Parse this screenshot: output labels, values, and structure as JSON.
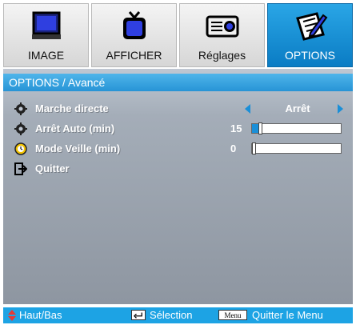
{
  "tabs": [
    {
      "label": "IMAGE",
      "icon": "monitor-icon",
      "active": false
    },
    {
      "label": "AFFICHER",
      "icon": "tv-icon",
      "active": false
    },
    {
      "label": "Réglages",
      "icon": "projector-icon",
      "active": false
    },
    {
      "label": "OPTIONS",
      "icon": "pencil-paper-icon",
      "active": true
    }
  ],
  "panel": {
    "title": "OPTIONS / Avancé",
    "rows": [
      {
        "label": "Marche directe",
        "icon": "gear-icon",
        "control": "select",
        "value": "Arrêt"
      },
      {
        "label": "Arrêt Auto (min)",
        "icon": "gear-icon",
        "control": "slider",
        "value": "15",
        "fraction": 0.08
      },
      {
        "label": "Mode Veille (min)",
        "icon": "clock-icon",
        "control": "slider",
        "value": "0",
        "fraction": 0.0
      },
      {
        "label": "Quitter",
        "icon": "exit-icon",
        "control": "none"
      }
    ]
  },
  "footer": {
    "nav_label": "Haut/Bas",
    "select_label": "Sélection",
    "menu_key": "Menu",
    "exit_label": "Quitter le Menu"
  },
  "colors": {
    "accent": "#1a8fd8",
    "active_tab": "#1a95d8",
    "footer": "#1da3e4"
  }
}
